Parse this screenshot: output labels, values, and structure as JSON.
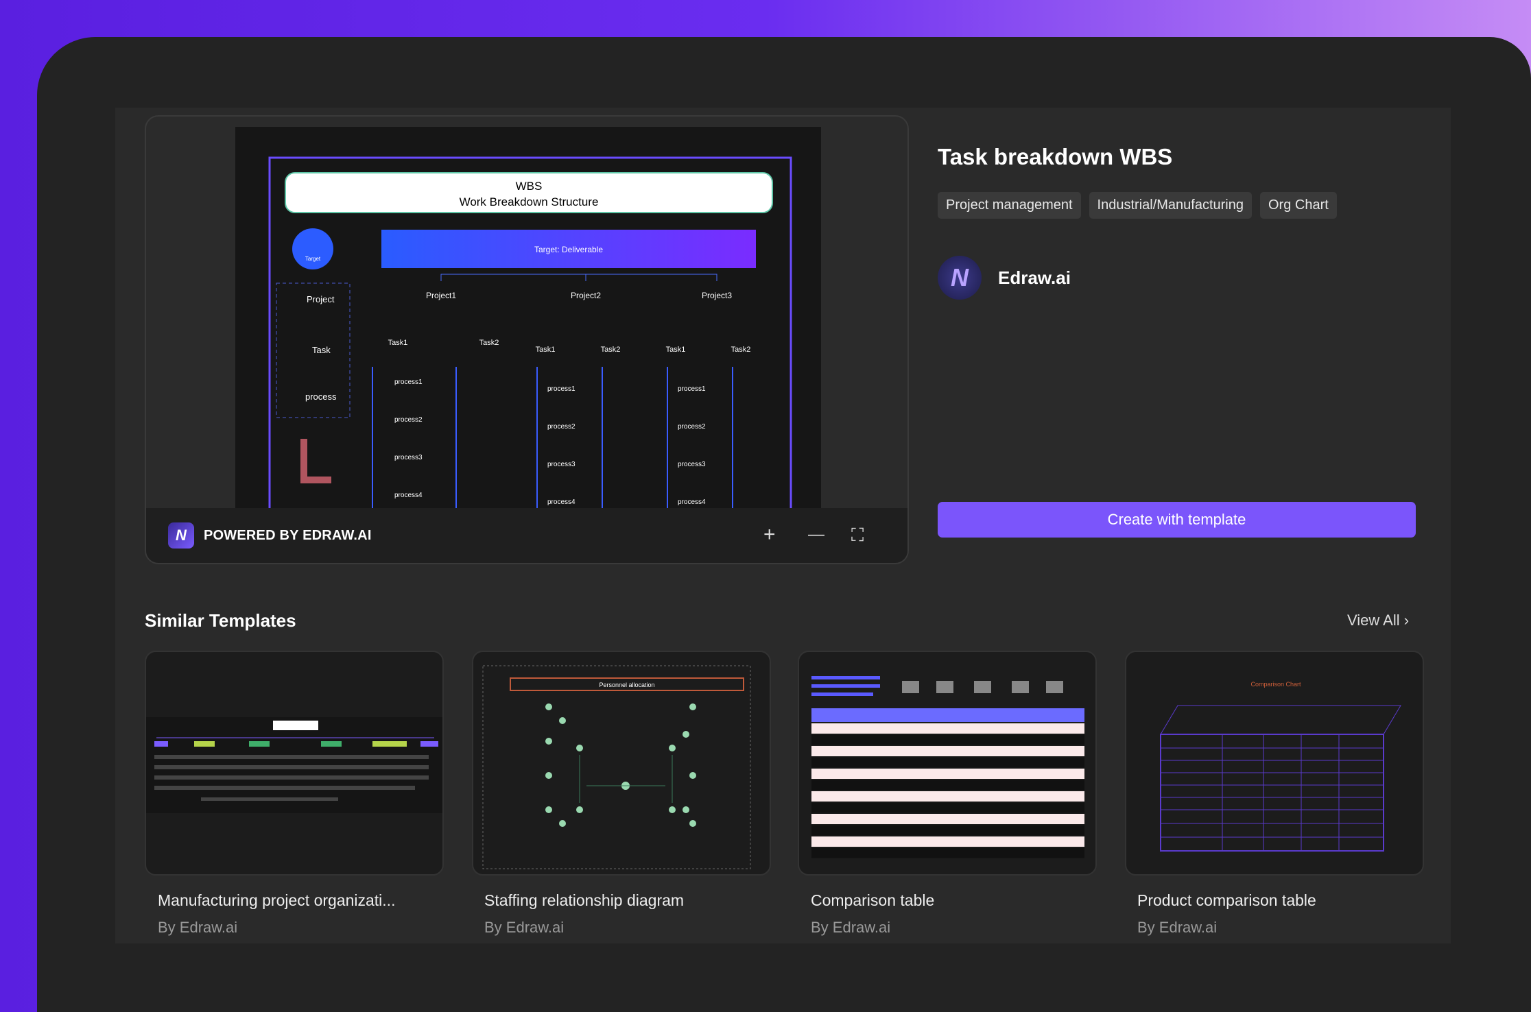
{
  "template": {
    "title": "Task breakdown WBS",
    "tags": [
      "Project management",
      "Industrial/Manufacturing",
      "Org Chart"
    ],
    "author": "Edraw.ai",
    "create_label": "Create with template"
  },
  "preview": {
    "powered_by": "POWERED BY EDRAW.AI",
    "zoom_in": "+",
    "zoom_out": "—",
    "fullscreen": "⛶",
    "diagram": {
      "title": "WBS",
      "subtitle": "Work Breakdown Structure",
      "target": "Target: Deliverable",
      "target_icon_label": "Target",
      "legend": [
        "Project",
        "Task",
        "process"
      ],
      "projects": [
        "Project1",
        "Project2",
        "Project3"
      ],
      "tasks": [
        "Task1",
        "Task2"
      ],
      "processes": [
        "process1",
        "process2",
        "process3",
        "process4"
      ]
    }
  },
  "similar": {
    "heading": "Similar Templates",
    "view_all": "View All",
    "items": [
      {
        "title": "Manufacturing project organizati...",
        "by": "By Edraw.ai"
      },
      {
        "title": "Staffing relationship diagram",
        "by": "By Edraw.ai",
        "thumb_title": "Personnel allocation"
      },
      {
        "title": "Comparison table",
        "by": "By Edraw.ai"
      },
      {
        "title": "Product comparison table",
        "by": "By Edraw.ai",
        "thumb_title": "Comparison Chart"
      }
    ]
  }
}
